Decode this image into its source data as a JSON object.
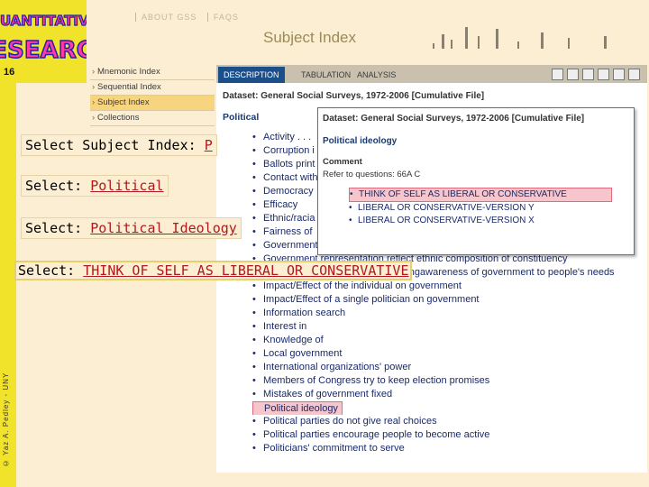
{
  "slide_number": "16",
  "logo": {
    "line1": "QUANTITATIVE",
    "line2": "RESEARCH"
  },
  "credit": "© Yaz A. Pedley - UNY",
  "header": {
    "top_links": [
      "ABOUT GSS",
      "FAQS"
    ],
    "subject_title": "Subject Index"
  },
  "left_nav": {
    "items": [
      {
        "label": "Mnemonic Index"
      },
      {
        "label": "Sequential Index"
      },
      {
        "label": "Subject Index"
      },
      {
        "label": "Collections"
      }
    ]
  },
  "tabs": [
    {
      "label": "DESCRIPTION"
    },
    {
      "label": "TABULATION"
    },
    {
      "label": "ANALYSIS"
    }
  ],
  "content": {
    "dataset_title": "Dataset: General Social Surveys, 1972-2006 [Cumulative File]",
    "section_title": "Political",
    "topics": [
      "Activity . . .",
      "Corruption i",
      "Ballots print",
      "Contact with",
      "Democracy",
      "Efficacy",
      "Ethnic/racia",
      "Fairness of",
      "Government interest in R's opinion",
      "Government representation reflect ethnic composition of constituency",
      "Impact/Effect of elections for raisingawareness of government to people's needs",
      "Impact/Effect of the individual on government",
      "Impact/Effect of a single politician on government",
      "Information search",
      "Interest in",
      "Knowledge of",
      "Local government",
      "International organizations' power",
      "Members of Congress try to keep election promises",
      "Mistakes of government fixed",
      "Political ideology",
      "Political parties do not give real choices",
      "Political parties encourage people to become active",
      "Politicians' commitment to serve"
    ]
  },
  "popup": {
    "title": "Dataset: General Social Surveys, 1972-2006 [Cumulative File]",
    "subtitle": "Political ideology",
    "comment_label": "Comment",
    "refer": "Refer to questions: 66A C",
    "items": [
      "THINK OF SELF AS LIBERAL OR CONSERVATIVE",
      "LIBERAL OR CONSERVATIVE-VERSION Y",
      "LIBERAL OR CONSERVATIVE-VERSION X"
    ]
  },
  "instructions": [
    {
      "prefix": "Select Subject Index:",
      "value": "P"
    },
    {
      "prefix": "Select:",
      "value": "Political"
    },
    {
      "prefix": "Select:",
      "value": "Political Ideology"
    },
    {
      "prefix": "Select:",
      "value": "THINK OF SELF AS LIBERAL OR CONSERVATIVE"
    }
  ],
  "colors": {
    "page_bg": "#fbeed2",
    "side_strip": "#f1e32a",
    "tab_active": "#1a4f8a",
    "highlight_fill": "#f6c6cc",
    "highlight_border": "#e56a7f",
    "instruction_value": "#b0191e"
  }
}
